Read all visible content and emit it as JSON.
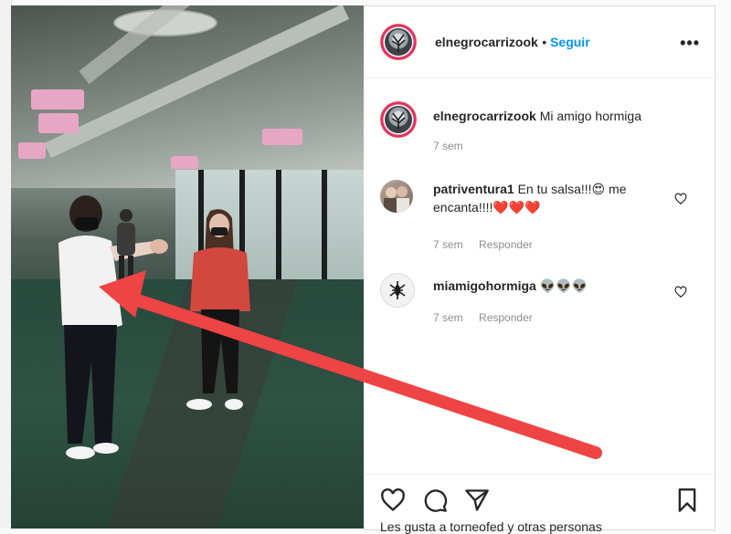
{
  "post": {
    "author": "elnegrocarrizook",
    "follow_label": "Seguir",
    "more_label": "•••",
    "caption_author": "elnegrocarrizook",
    "caption_text": "Mi amigo hormiga",
    "caption_time": "7 sem"
  },
  "comments": [
    {
      "user": "patriventura1",
      "text_1": "En tu salsa!!!",
      "emoji_1": "😍",
      "text_2": " me",
      "text_3": "encanta!!!!",
      "emoji_2": "❤️❤️❤️",
      "time": "7 sem",
      "reply_label": "Responder"
    },
    {
      "user": "miamigohormiga",
      "emoji": "👽👽👽",
      "time": "7 sem",
      "reply_label": "Responder"
    }
  ],
  "likes_text": "Les gusta a torneofed y otras personas",
  "colors": {
    "accent": "#0095f6",
    "arrow": "#ef4444",
    "muted": "#8e8e8e"
  }
}
